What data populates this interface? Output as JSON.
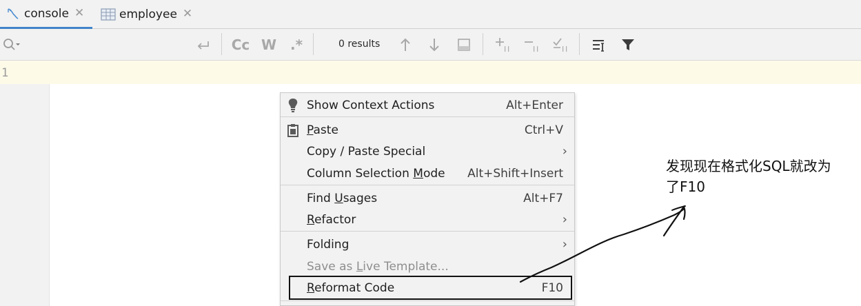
{
  "tabs": [
    {
      "label": "console",
      "icon": "sql-console-icon",
      "active": true
    },
    {
      "label": "employee",
      "icon": "table-icon",
      "active": false
    }
  ],
  "toolbar": {
    "results_text": "0 results",
    "match_case_label": "Cc",
    "words_label": "W",
    "regex_label": ".*"
  },
  "editor": {
    "line_number": "1"
  },
  "context_menu": {
    "items": [
      {
        "label": "Show Context Actions",
        "shortcut": "Alt+Enter",
        "icon": "lightbulb-icon"
      },
      {
        "label_pre": "",
        "label_u": "P",
        "label_post": "aste",
        "shortcut": "Ctrl+V",
        "icon": "clipboard-icon"
      },
      {
        "label": "Copy / Paste Special",
        "submenu": "›"
      },
      {
        "label_pre": "Column Selection ",
        "label_u": "M",
        "label_post": "ode",
        "shortcut": "Alt+Shift+Insert"
      },
      {
        "label_pre": "Find ",
        "label_u": "U",
        "label_post": "sages",
        "shortcut": "Alt+F7"
      },
      {
        "label_pre": "",
        "label_u": "R",
        "label_post": "efactor",
        "submenu": "›"
      },
      {
        "label": "Folding",
        "submenu": "›"
      },
      {
        "label_pre": "Save as ",
        "label_u": "L",
        "label_post": "ive Template...",
        "disabled": true
      },
      {
        "label_pre": "",
        "label_u": "R",
        "label_post": "eformat Code",
        "shortcut": "F10"
      }
    ]
  },
  "annotation": {
    "line1": "发现现在格式化SQL就改为",
    "line2": "了F10"
  },
  "colors": {
    "tab_active_underline": "#4083c9",
    "current_line_bg": "#fdfae8",
    "menu_bg": "#f2f2f2"
  }
}
